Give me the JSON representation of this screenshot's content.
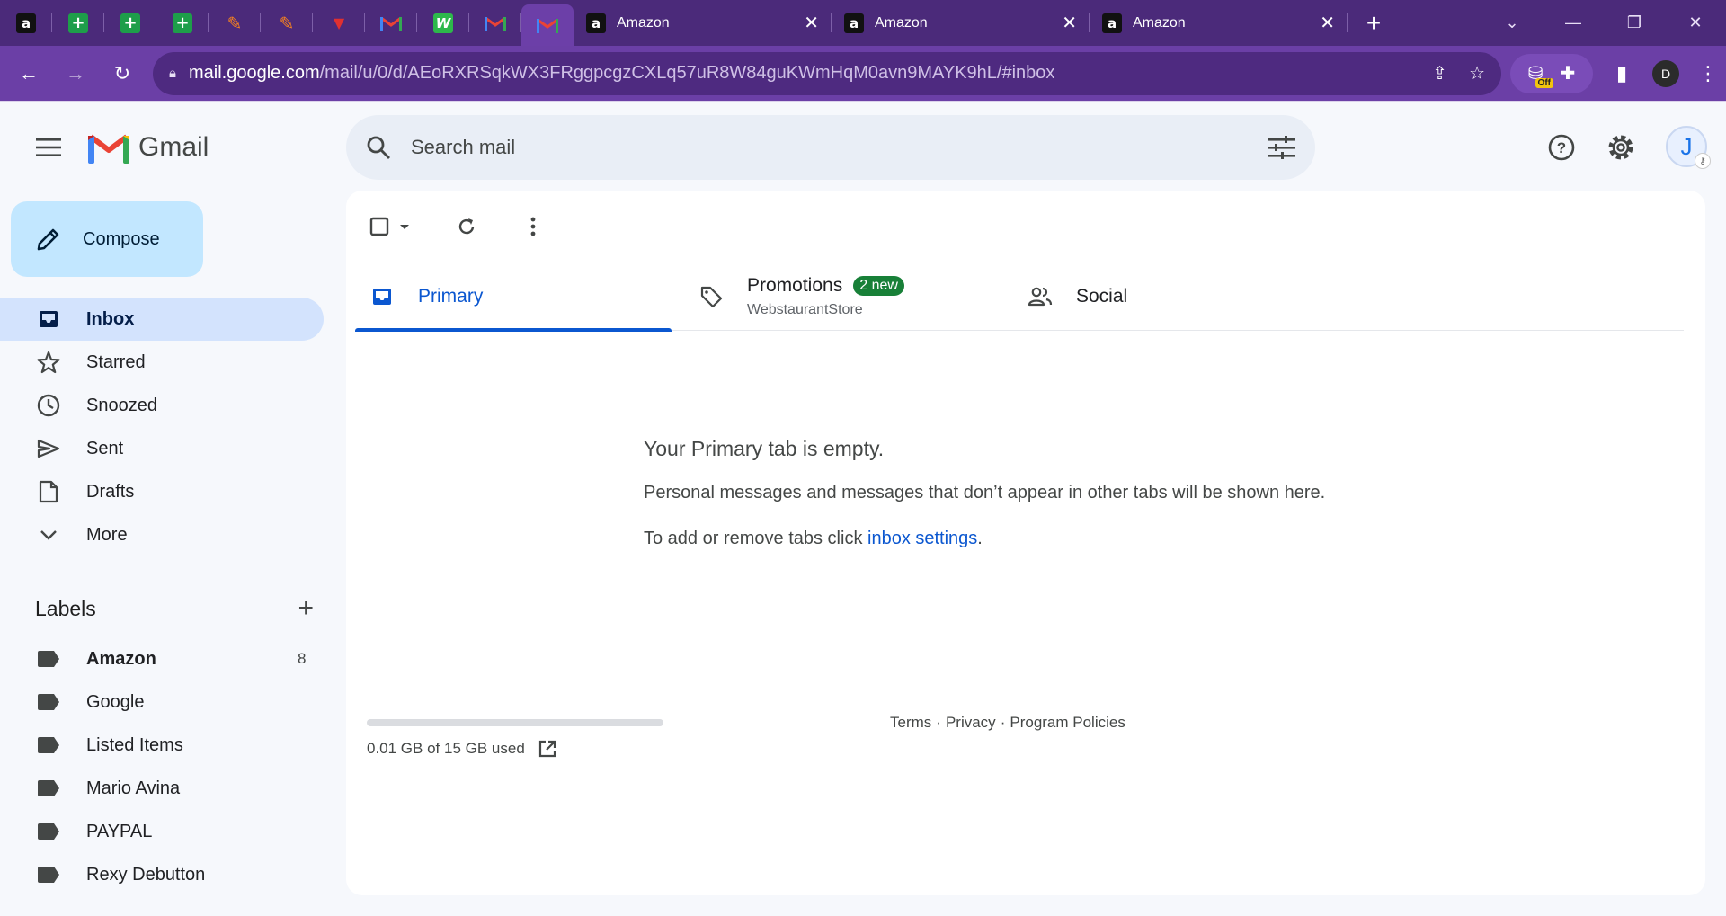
{
  "browser": {
    "pinned_tabs": [
      "amazon",
      "sheets",
      "sheets",
      "sheets",
      "orange",
      "orange",
      "red",
      "gmail",
      "green",
      "gmail",
      "gmail-active"
    ],
    "tabs": [
      {
        "title": "Amazon"
      },
      {
        "title": "Amazon"
      },
      {
        "title": "Amazon"
      }
    ],
    "url_host": "mail.google.com",
    "url_path": "/mail/u/0/d/AEoRXRSqkWX3FRggpcgzCXLq57uR8W84guKWmHqM0avn9MAYK9hL/#inbox",
    "ext_off_badge": "Off",
    "profile_initial": "D"
  },
  "gmail": {
    "logo_text": "Gmail",
    "search_placeholder": "Search mail",
    "avatar_initial": "J",
    "compose_label": "Compose",
    "nav": [
      {
        "label": "Inbox",
        "icon": "inbox-icon",
        "active": true
      },
      {
        "label": "Starred",
        "icon": "star-icon"
      },
      {
        "label": "Snoozed",
        "icon": "clock-icon"
      },
      {
        "label": "Sent",
        "icon": "send-icon"
      },
      {
        "label": "Drafts",
        "icon": "draft-icon"
      },
      {
        "label": "More",
        "icon": "chevron-down-icon"
      }
    ],
    "labels_title": "Labels",
    "labels": [
      {
        "name": "Amazon",
        "count": "8",
        "bold": true
      },
      {
        "name": "Google",
        "count": ""
      },
      {
        "name": "Listed Items",
        "count": ""
      },
      {
        "name": "Mario Avina",
        "count": ""
      },
      {
        "name": "PAYPAL",
        "count": ""
      },
      {
        "name": "Rexy Debutton",
        "count": ""
      }
    ],
    "tabs": {
      "primary": {
        "label": "Primary"
      },
      "promotions": {
        "label": "Promotions",
        "badge": "2 new",
        "sub": "WebstaurantStore"
      },
      "social": {
        "label": "Social"
      }
    },
    "empty": {
      "title": "Your Primary tab is empty.",
      "text": "Personal messages and messages that don’t appear in other tabs will be shown here.",
      "text2_prefix": "To add or remove tabs click ",
      "link": "inbox settings",
      "text2_suffix": "."
    },
    "storage": {
      "text": "0.01 GB of 15 GB used",
      "used_fraction": 0.001
    },
    "footer": {
      "terms": "Terms",
      "privacy": "Privacy",
      "policies": "Program Policies",
      "separator": "·"
    }
  }
}
